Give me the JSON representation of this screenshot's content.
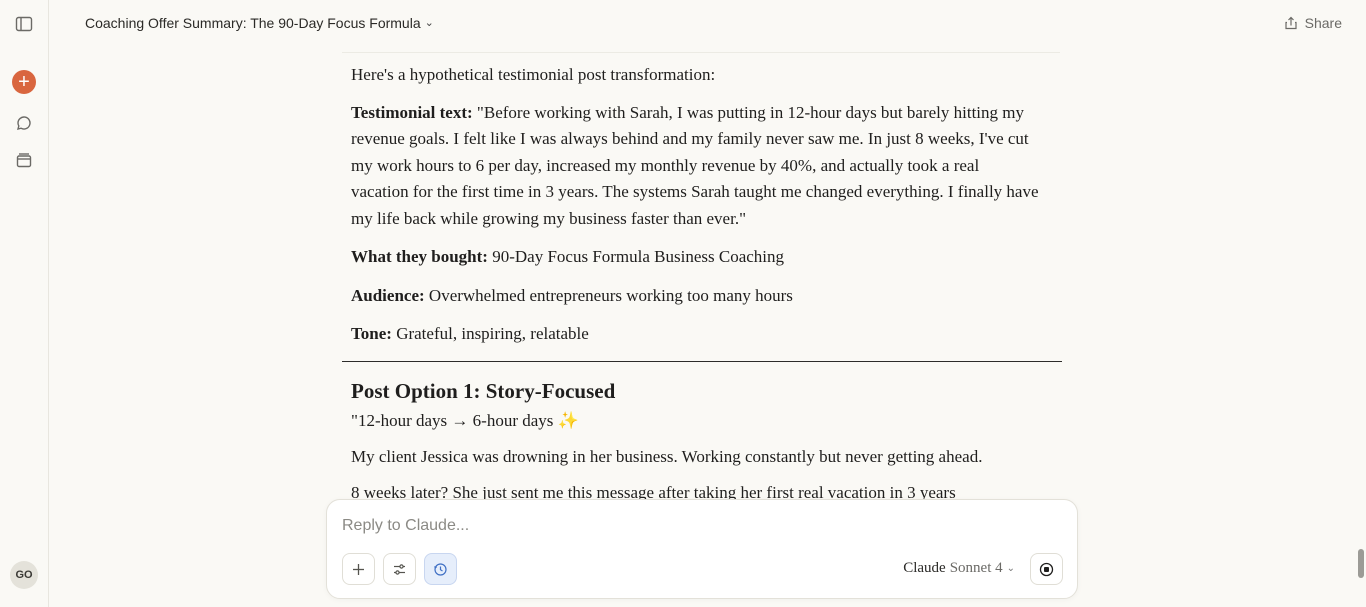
{
  "header": {
    "title": "Coaching Offer Summary: The 90-Day Focus Formula",
    "share_label": "Share"
  },
  "sidebar": {
    "avatar_initials": "GO",
    "new_chat_symbol": "+"
  },
  "message": {
    "intro": "Here's a hypothetical testimonial post transformation:",
    "testimonial_label": "Testimonial text:",
    "testimonial_text": " \"Before working with Sarah, I was putting in 12-hour days but barely hitting my revenue goals. I felt like I was always behind and my family never saw me. In just 8 weeks, I've cut my work hours to 6 per day, increased my monthly revenue by 40%, and actually took a real vacation for the first time in 3 years. The systems Sarah taught me changed everything. I finally have my life back while growing my business faster than ever.\"",
    "bought_label": "What they bought:",
    "bought_value": " 90-Day Focus Formula Business Coaching",
    "audience_label": "Audience:",
    "audience_value": " Overwhelmed entrepreneurs working too many hours",
    "tone_label": "Tone:",
    "tone_value": " Grateful, inspiring, relatable",
    "post_heading": "Post Option 1: Story-Focused",
    "post_line1": "\"12-hour days → 6-hour days ",
    "post_line1_emoji": "✨",
    "post_line2": "My client Jessica was drowning in her business. Working constantly but never getting ahead.",
    "post_line3": "8 weeks later? She just sent me this message after taking her first real vacation in 3 years"
  },
  "composer": {
    "placeholder": "Reply to Claude...",
    "model_name": "Claude",
    "model_version": "Sonnet 4"
  },
  "colors": {
    "accent": "#d9663f",
    "background": "#faf9f5",
    "active_tool": "#e6eefb"
  }
}
